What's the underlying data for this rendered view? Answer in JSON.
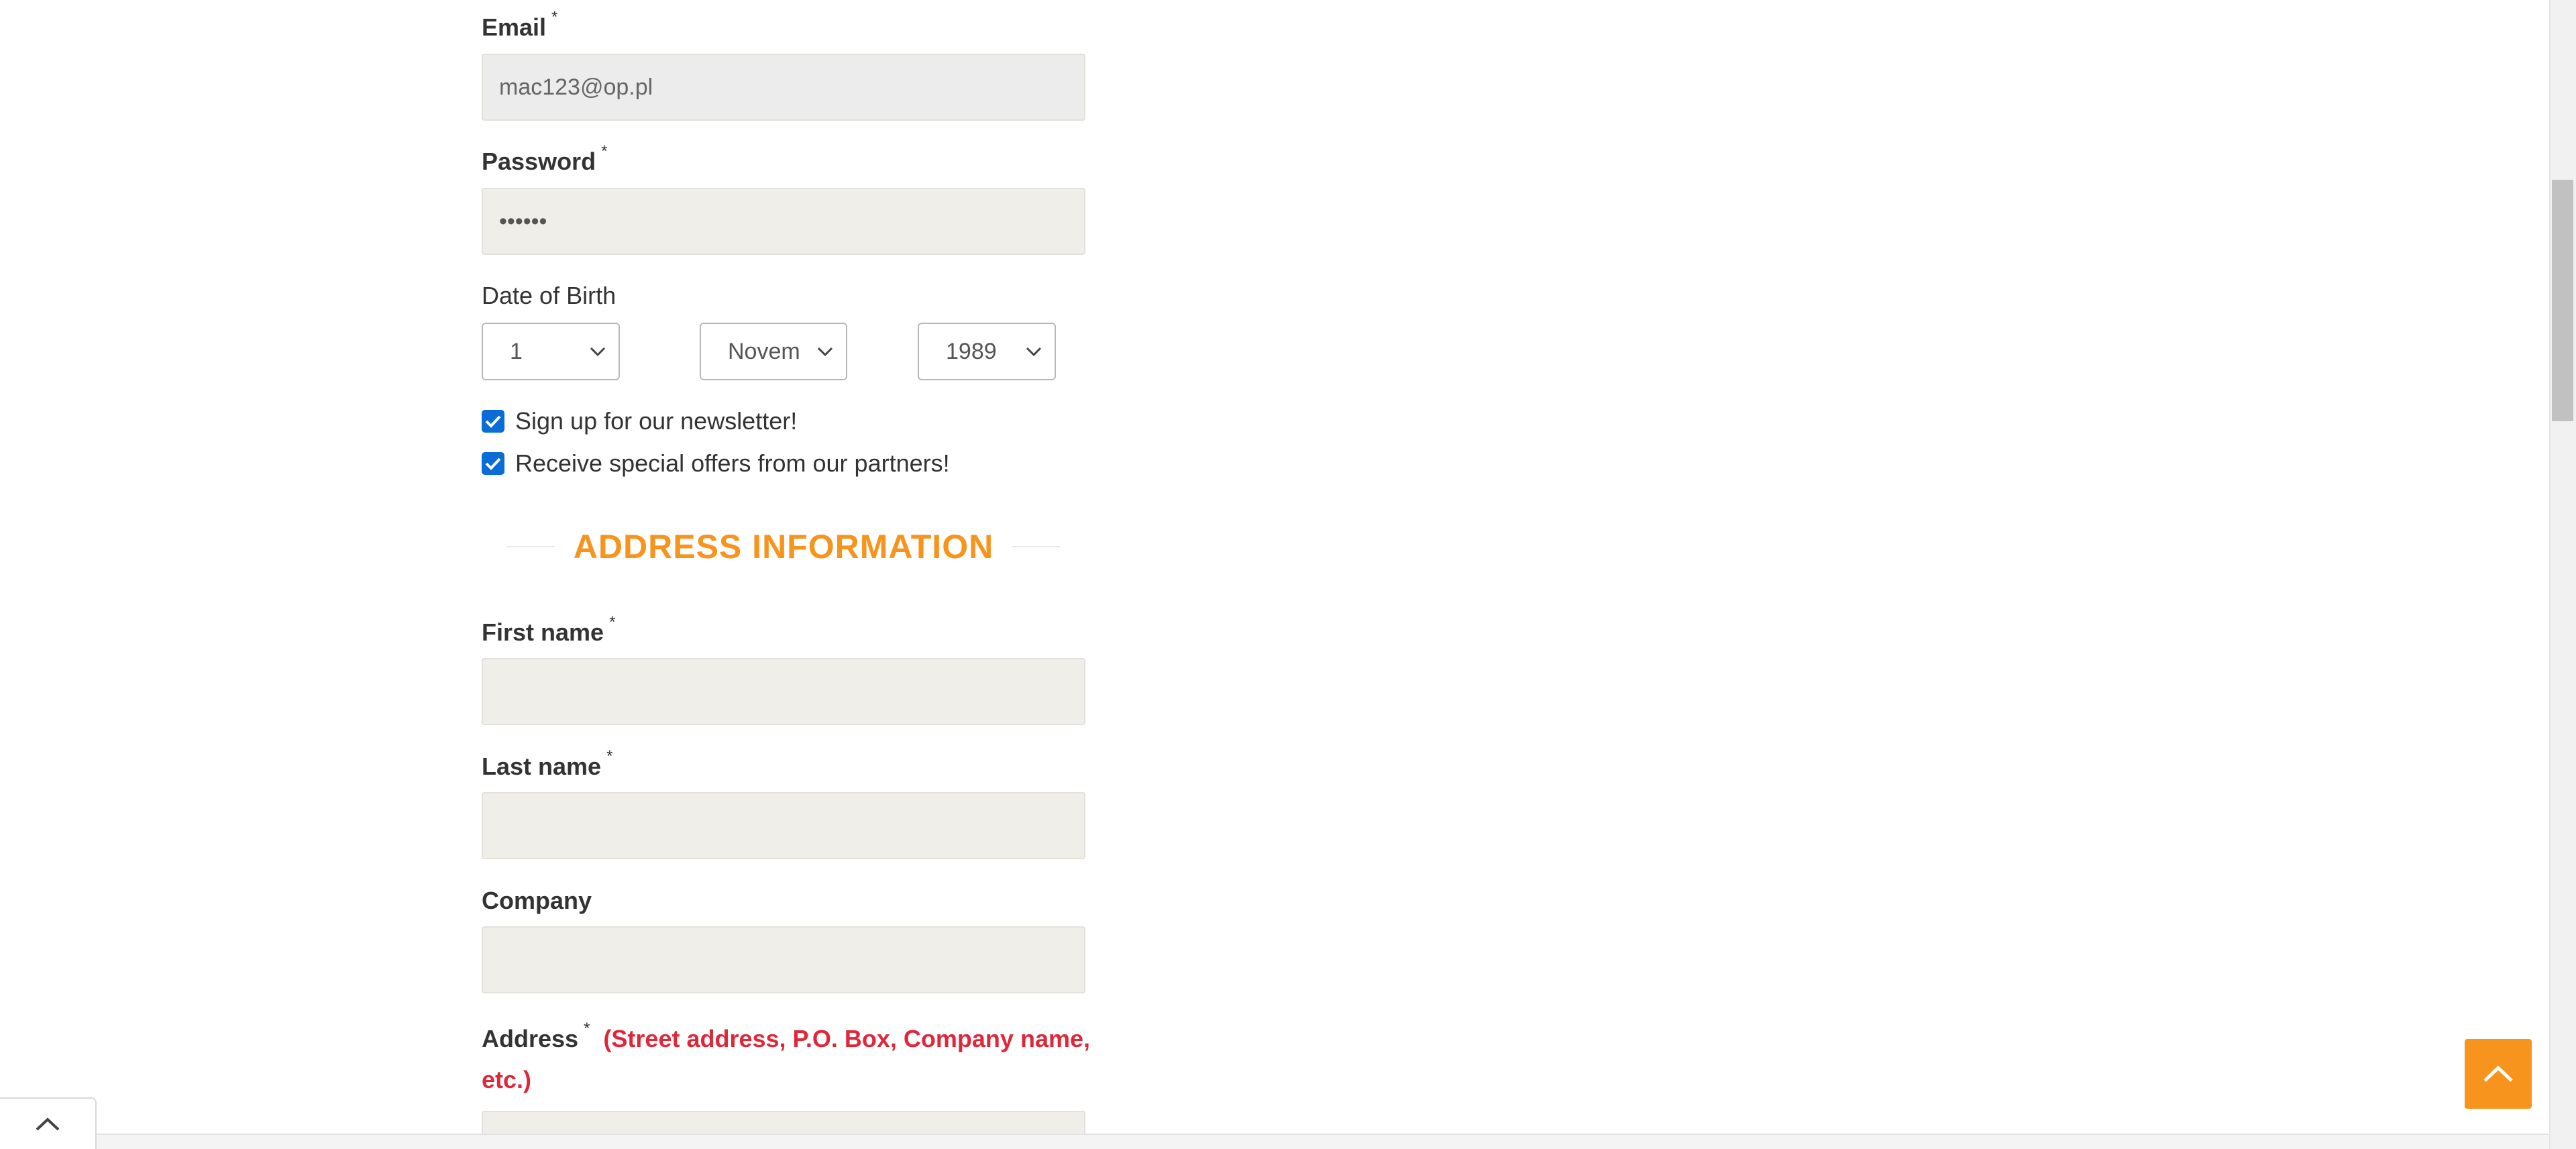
{
  "form": {
    "email": {
      "label": "Email",
      "required_mark": "*",
      "value": "mac123@op.pl"
    },
    "password": {
      "label": "Password",
      "required_mark": "*",
      "value": "••••••"
    },
    "date_of_birth": {
      "label": "Date of Birth",
      "day": "1",
      "month": "Novem",
      "year": "1989"
    },
    "newsletter": {
      "label": "Sign up for our newsletter!",
      "checked": true
    },
    "offers": {
      "label": "Receive special offers from our partners!",
      "checked": true
    },
    "address_section": {
      "title": "ADDRESS INFORMATION"
    },
    "first_name": {
      "label": "First name",
      "required_mark": "*",
      "value": ""
    },
    "last_name": {
      "label": "Last name",
      "required_mark": "*",
      "value": ""
    },
    "company": {
      "label": "Company",
      "value": ""
    },
    "address": {
      "label": "Address",
      "required_mark": "*",
      "hint_line1": "(Street address, P.O. Box, Company name,",
      "hint_line2": "etc.)",
      "value": ""
    }
  },
  "colors": {
    "accent": "#f7941d",
    "hint_red": "#e0273a",
    "checkbox_blue": "#0a6cd6",
    "input_bg": "#efeee8"
  },
  "icons": {
    "back_to_top": "chevron-up-icon",
    "bottom_toggle": "chevron-up-icon",
    "select_arrow": "chevron-down-icon",
    "checkbox_mark": "checkmark-icon"
  }
}
